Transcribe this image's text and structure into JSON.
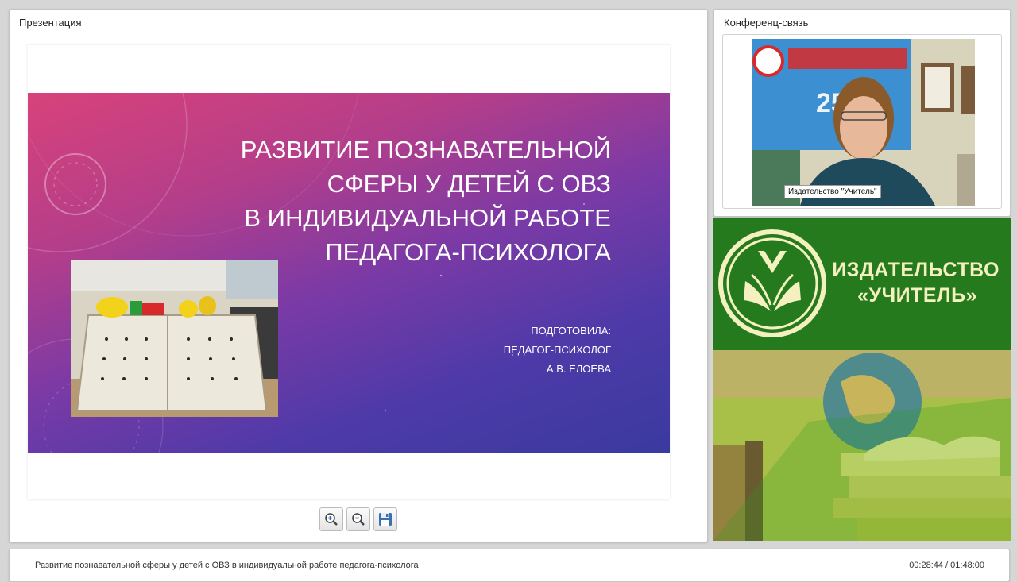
{
  "presentation": {
    "panel_title": "Презентация",
    "slide": {
      "title_lines": [
        "Развитие познавательной",
        "сферы у детей с ОВЗ",
        "в индивидуальной работе",
        "педагога-психолога"
      ],
      "author_lines": [
        "Подготовила:",
        "педагог-психолог",
        "А.В. Елоева"
      ]
    },
    "toolbar": {
      "zoom_in_icon": "zoom-in-icon",
      "zoom_out_icon": "zoom-out-icon",
      "save_icon": "floppy-disk-icon"
    }
  },
  "conference": {
    "panel_title": "Конференц-связь",
    "video_label": "Издательство \"Учитель\""
  },
  "banner": {
    "line1": "ИЗДАТЕЛЬСТВО",
    "line2": "«УЧИТЕЛЬ»",
    "colors": {
      "background": "#247a1c",
      "text": "#f4f0c0"
    }
  },
  "status_bar": {
    "title": "Развитие познавательной сферы у детей с ОВЗ в индивидуальной работе педагога-психолога",
    "time": "00:28:44 / 01:48:00"
  }
}
